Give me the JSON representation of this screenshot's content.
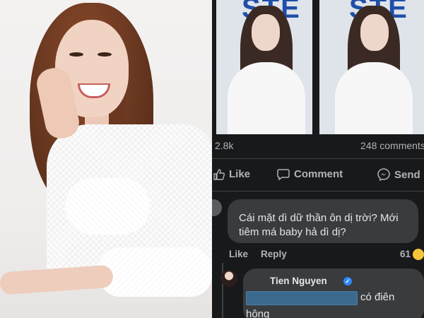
{
  "video": {
    "sign_text": "STE"
  },
  "post": {
    "likes_count": "2.8k",
    "comments_count": "248 comments"
  },
  "actions": {
    "like_label": "Like",
    "comment_label": "Comment",
    "send_label": "Send"
  },
  "comments": [
    {
      "text_line_1": "Cái mặt dì dữ thần ôn dị trời? Mới",
      "text_line_2": "tiêm má baby hả dì dị?",
      "like_label": "Like",
      "reply_label": "Reply",
      "reaction_count": "61"
    },
    {
      "author": "Tien Nguyen",
      "verified": true,
      "text_line_1": "có điên",
      "text_line_2": "hông"
    }
  ],
  "colors": {
    "facebook_dark_bg": "#18191a",
    "bubble_bg": "#3a3b3c",
    "muted_text": "#b0b3b8",
    "verified_blue": "#2d88ff"
  }
}
